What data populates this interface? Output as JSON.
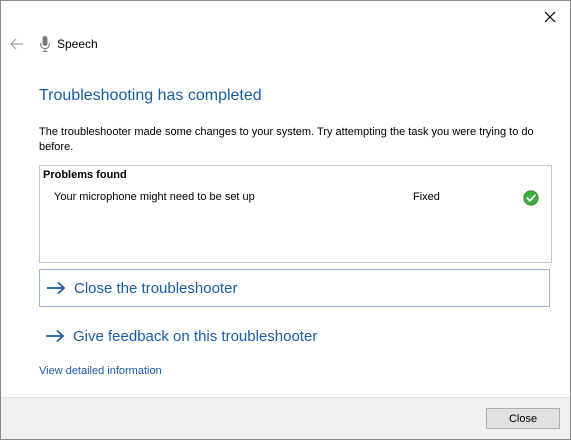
{
  "header": {
    "title": "Speech",
    "back_icon": "back-arrow-icon",
    "app_icon": "microphone-icon",
    "close_icon": "close-icon"
  },
  "main": {
    "heading": "Troubleshooting has completed",
    "description": "The troubleshooter made some changes to your system. Try attempting the task you were trying to do before."
  },
  "problems": {
    "heading": "Problems found",
    "items": [
      {
        "name": "Your microphone might need to be set up",
        "status": "Fixed",
        "status_icon": "green-check-icon"
      }
    ]
  },
  "actions": {
    "close_troubleshooter": "Close the troubleshooter",
    "give_feedback": "Give feedback on this troubleshooter",
    "arrow_icon": "right-arrow-icon"
  },
  "details_link": "View detailed information",
  "footer": {
    "close_label": "Close"
  },
  "colors": {
    "accent": "#1a5ba6",
    "success": "#3fae3f",
    "footer_bg": "#f0f0f0"
  }
}
